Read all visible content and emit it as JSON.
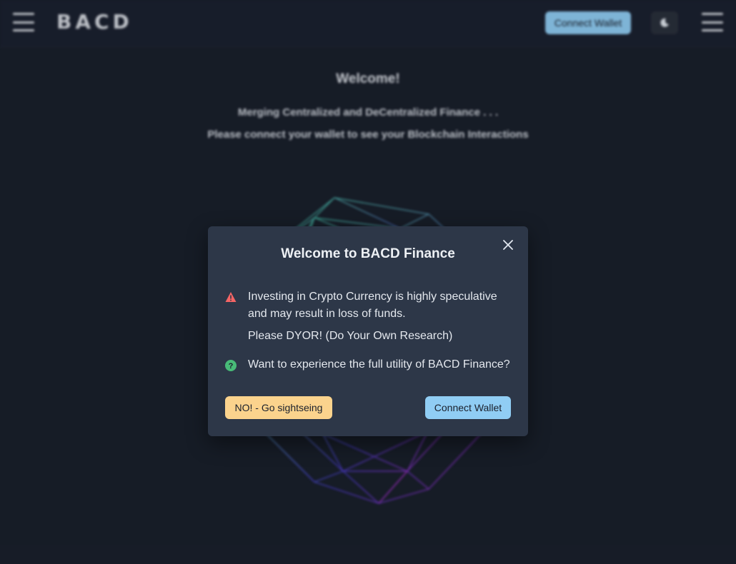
{
  "header": {
    "logo": "BACD",
    "connect_label": "Connect Wallet"
  },
  "hero": {
    "title": "Welcome!",
    "line1": "Merging Centralized and DeCentralized Finance . . .",
    "line2": "Please connect your wallet to see your Blockchain Interactions"
  },
  "modal": {
    "title": "Welcome to BACD Finance",
    "warning": "Investing in Crypto Currency is highly speculative and may result in loss of funds.",
    "dyor": "Please DYOR! (Do Your Own Research)",
    "question": "Want to experience the full utility of BACD Finance?",
    "decline_label": "NO! - Go sightseing",
    "connect_label": "Connect Wallet"
  },
  "colors": {
    "background": "#1a202c",
    "modal": "#2d3748",
    "accent_blue": "#90cdf4",
    "accent_orange": "#fbd38d",
    "warning_red": "#f56565",
    "question_green": "#48bb78"
  },
  "icons": {
    "menu": "hamburger-icon",
    "theme": "moon-icon",
    "close": "close-icon",
    "warning": "warning-icon",
    "question": "question-icon"
  }
}
